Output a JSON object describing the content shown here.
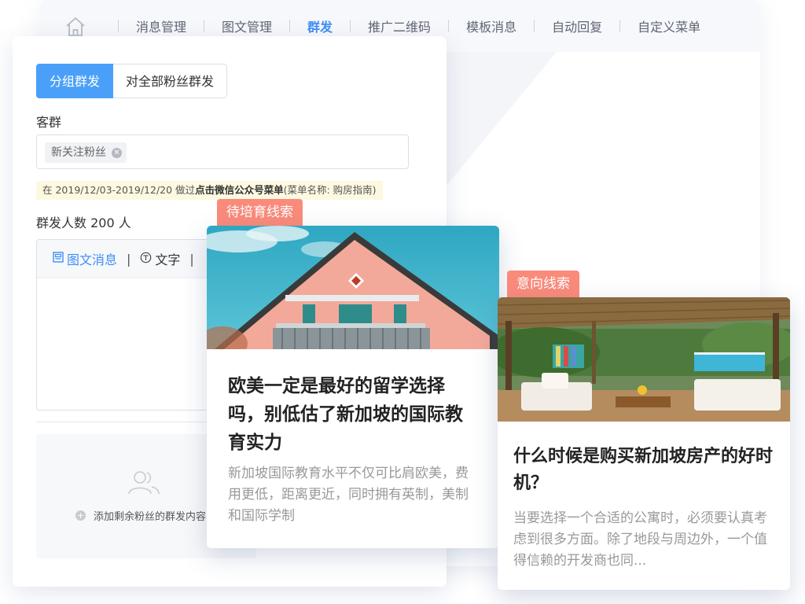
{
  "nav": {
    "items": [
      "消息管理",
      "图文管理",
      "群发",
      "推广二维码",
      "模板消息",
      "自动回复",
      "自定义菜单"
    ],
    "active_index": 2
  },
  "panel": {
    "seg_group": "分组群发",
    "seg_all": "对全部粉丝群发",
    "audience_label": "客群",
    "chip_label": "新关注粉丝",
    "hint_prefix": "在 2019/12/03-2019/12/20 做过",
    "hint_bold": "点击微信公众号菜单",
    "hint_suffix": "(菜单名称: 购房指南)",
    "count_label": "群发人数 200 人",
    "tab_news": "图文消息",
    "tab_text": "文字",
    "add_remaining": "添加剩余粉丝的群发内容"
  },
  "cards": [
    {
      "badge": "待培育线索",
      "title": "欧美一定是最好的留学选择吗，别低估了新加坡的国际教育实力",
      "desc": "新加坡国际教育水平不仅可比肩欧美，费用更低，距离更近，同时拥有英制，美制和国际学制"
    },
    {
      "badge": "意向线索",
      "title": "什么时候是购买新加坡房产的好时机？",
      "desc": "当要选择一个合适的公寓时，必须要认真考虑到很多方面。除了地段与周边外，一个值得信赖的开发商也同..."
    }
  ],
  "colors": {
    "accent": "#4aa0f8",
    "badge": "#fa8b7b",
    "hint_bg": "#fdf9e1"
  }
}
